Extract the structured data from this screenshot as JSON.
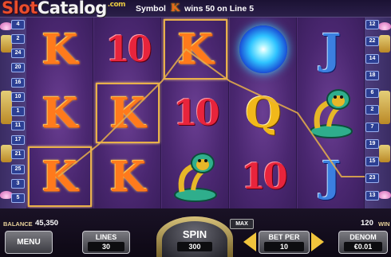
{
  "brand": {
    "part1": "Slot",
    "part2": "Catalog",
    "part3": ".com"
  },
  "win_message": {
    "prefix": "Symbol",
    "symbol_glyph": "K",
    "suffix": "wins 50 on Line 5"
  },
  "paylines": {
    "left": [
      "4",
      "2",
      "24",
      "20",
      "16",
      "10",
      "1",
      "11",
      "17",
      "21",
      "25",
      "3",
      "5"
    ],
    "right": [
      "12",
      "22",
      "14",
      "18",
      "6",
      "2",
      "7",
      "19",
      "15",
      "23",
      "13"
    ]
  },
  "reels": [
    [
      {
        "type": "K",
        "label": "K"
      },
      {
        "type": "K",
        "label": "K"
      },
      {
        "type": "K",
        "label": "K"
      }
    ],
    [
      {
        "type": "10",
        "label": "10"
      },
      {
        "type": "K",
        "label": "K"
      },
      {
        "type": "K",
        "label": "K"
      }
    ],
    [
      {
        "type": "K",
        "label": "K"
      },
      {
        "type": "10",
        "label": "10"
      },
      {
        "type": "cobra",
        "label": ""
      }
    ],
    [
      {
        "type": "orb",
        "label": ""
      },
      {
        "type": "Q",
        "label": "Q"
      },
      {
        "type": "10",
        "label": "10"
      }
    ],
    [
      {
        "type": "J",
        "label": "J"
      },
      {
        "type": "cobra",
        "label": ""
      },
      {
        "type": "J",
        "label": "J"
      }
    ]
  ],
  "bottom": {
    "balance_label": "BALANCE",
    "balance_value": "45,350",
    "total_bet_value": "120",
    "win_label": "WIN",
    "menu_label": "MENU",
    "lines_label": "LINES",
    "lines_value": "30",
    "spin_label": "SPIN",
    "spin_value": "300",
    "max_label": "MAX",
    "betper_label": "BET PER",
    "betper_value": "10",
    "denom_label": "DENOM",
    "denom_value": "€0.01"
  },
  "colors": {
    "k_symbol": "#ff7a1c",
    "ten_symbol": "#e8243c",
    "j_symbol": "#3b7fe0",
    "q_symbol": "#f1b81a",
    "win_frame": "#e8b04a",
    "reel_bg": "#4e2c74"
  }
}
